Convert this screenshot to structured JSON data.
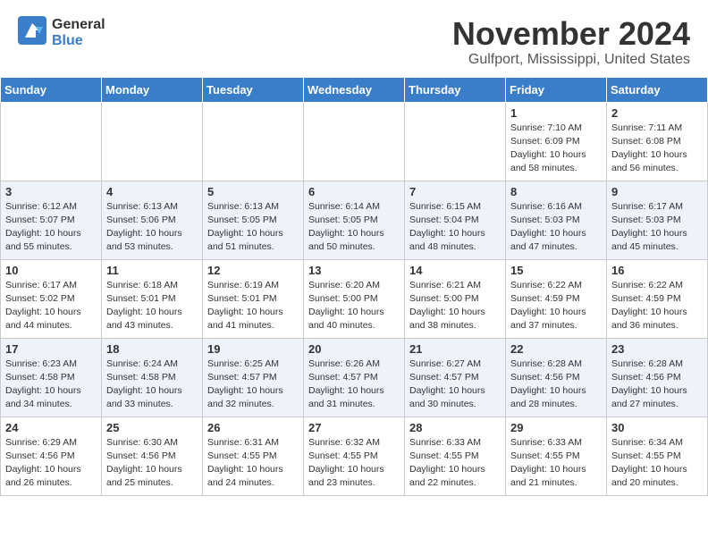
{
  "header": {
    "logo_general": "General",
    "logo_blue": "Blue",
    "title": "November 2024",
    "location": "Gulfport, Mississippi, United States"
  },
  "days_of_week": [
    "Sunday",
    "Monday",
    "Tuesday",
    "Wednesday",
    "Thursday",
    "Friday",
    "Saturday"
  ],
  "weeks": [
    [
      {
        "day": "",
        "info": ""
      },
      {
        "day": "",
        "info": ""
      },
      {
        "day": "",
        "info": ""
      },
      {
        "day": "",
        "info": ""
      },
      {
        "day": "",
        "info": ""
      },
      {
        "day": "1",
        "info": "Sunrise: 7:10 AM\nSunset: 6:09 PM\nDaylight: 10 hours\nand 58 minutes."
      },
      {
        "day": "2",
        "info": "Sunrise: 7:11 AM\nSunset: 6:08 PM\nDaylight: 10 hours\nand 56 minutes."
      }
    ],
    [
      {
        "day": "3",
        "info": "Sunrise: 6:12 AM\nSunset: 5:07 PM\nDaylight: 10 hours\nand 55 minutes."
      },
      {
        "day": "4",
        "info": "Sunrise: 6:13 AM\nSunset: 5:06 PM\nDaylight: 10 hours\nand 53 minutes."
      },
      {
        "day": "5",
        "info": "Sunrise: 6:13 AM\nSunset: 5:05 PM\nDaylight: 10 hours\nand 51 minutes."
      },
      {
        "day": "6",
        "info": "Sunrise: 6:14 AM\nSunset: 5:05 PM\nDaylight: 10 hours\nand 50 minutes."
      },
      {
        "day": "7",
        "info": "Sunrise: 6:15 AM\nSunset: 5:04 PM\nDaylight: 10 hours\nand 48 minutes."
      },
      {
        "day": "8",
        "info": "Sunrise: 6:16 AM\nSunset: 5:03 PM\nDaylight: 10 hours\nand 47 minutes."
      },
      {
        "day": "9",
        "info": "Sunrise: 6:17 AM\nSunset: 5:03 PM\nDaylight: 10 hours\nand 45 minutes."
      }
    ],
    [
      {
        "day": "10",
        "info": "Sunrise: 6:17 AM\nSunset: 5:02 PM\nDaylight: 10 hours\nand 44 minutes."
      },
      {
        "day": "11",
        "info": "Sunrise: 6:18 AM\nSunset: 5:01 PM\nDaylight: 10 hours\nand 43 minutes."
      },
      {
        "day": "12",
        "info": "Sunrise: 6:19 AM\nSunset: 5:01 PM\nDaylight: 10 hours\nand 41 minutes."
      },
      {
        "day": "13",
        "info": "Sunrise: 6:20 AM\nSunset: 5:00 PM\nDaylight: 10 hours\nand 40 minutes."
      },
      {
        "day": "14",
        "info": "Sunrise: 6:21 AM\nSunset: 5:00 PM\nDaylight: 10 hours\nand 38 minutes."
      },
      {
        "day": "15",
        "info": "Sunrise: 6:22 AM\nSunset: 4:59 PM\nDaylight: 10 hours\nand 37 minutes."
      },
      {
        "day": "16",
        "info": "Sunrise: 6:22 AM\nSunset: 4:59 PM\nDaylight: 10 hours\nand 36 minutes."
      }
    ],
    [
      {
        "day": "17",
        "info": "Sunrise: 6:23 AM\nSunset: 4:58 PM\nDaylight: 10 hours\nand 34 minutes."
      },
      {
        "day": "18",
        "info": "Sunrise: 6:24 AM\nSunset: 4:58 PM\nDaylight: 10 hours\nand 33 minutes."
      },
      {
        "day": "19",
        "info": "Sunrise: 6:25 AM\nSunset: 4:57 PM\nDaylight: 10 hours\nand 32 minutes."
      },
      {
        "day": "20",
        "info": "Sunrise: 6:26 AM\nSunset: 4:57 PM\nDaylight: 10 hours\nand 31 minutes."
      },
      {
        "day": "21",
        "info": "Sunrise: 6:27 AM\nSunset: 4:57 PM\nDaylight: 10 hours\nand 30 minutes."
      },
      {
        "day": "22",
        "info": "Sunrise: 6:28 AM\nSunset: 4:56 PM\nDaylight: 10 hours\nand 28 minutes."
      },
      {
        "day": "23",
        "info": "Sunrise: 6:28 AM\nSunset: 4:56 PM\nDaylight: 10 hours\nand 27 minutes."
      }
    ],
    [
      {
        "day": "24",
        "info": "Sunrise: 6:29 AM\nSunset: 4:56 PM\nDaylight: 10 hours\nand 26 minutes."
      },
      {
        "day": "25",
        "info": "Sunrise: 6:30 AM\nSunset: 4:56 PM\nDaylight: 10 hours\nand 25 minutes."
      },
      {
        "day": "26",
        "info": "Sunrise: 6:31 AM\nSunset: 4:55 PM\nDaylight: 10 hours\nand 24 minutes."
      },
      {
        "day": "27",
        "info": "Sunrise: 6:32 AM\nSunset: 4:55 PM\nDaylight: 10 hours\nand 23 minutes."
      },
      {
        "day": "28",
        "info": "Sunrise: 6:33 AM\nSunset: 4:55 PM\nDaylight: 10 hours\nand 22 minutes."
      },
      {
        "day": "29",
        "info": "Sunrise: 6:33 AM\nSunset: 4:55 PM\nDaylight: 10 hours\nand 21 minutes."
      },
      {
        "day": "30",
        "info": "Sunrise: 6:34 AM\nSunset: 4:55 PM\nDaylight: 10 hours\nand 20 minutes."
      }
    ]
  ]
}
